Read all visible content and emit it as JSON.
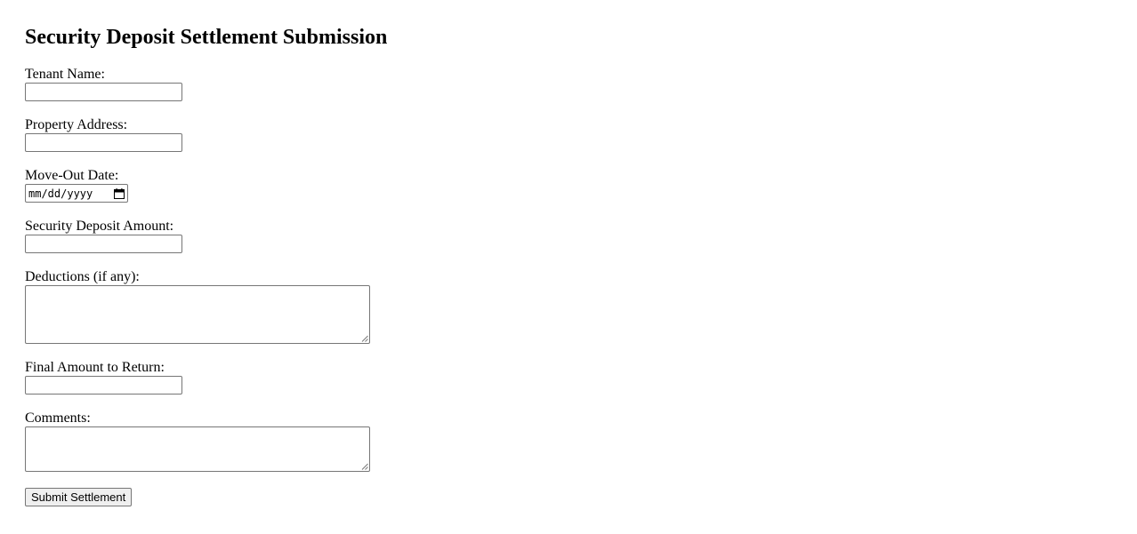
{
  "form": {
    "title": "Security Deposit Settlement Submission",
    "fields": {
      "tenant_name": {
        "label": "Tenant Name:",
        "value": ""
      },
      "property_address": {
        "label": "Property Address:",
        "value": ""
      },
      "move_out_date": {
        "label": "Move-Out Date:",
        "placeholder": "mm/dd/yyyy",
        "icon": "calendar-icon"
      },
      "deposit_amount": {
        "label": "Security Deposit Amount:",
        "value": ""
      },
      "deductions": {
        "label": "Deductions (if any):",
        "value": ""
      },
      "final_amount": {
        "label": "Final Amount to Return:",
        "value": ""
      },
      "comments": {
        "label": "Comments:",
        "value": ""
      }
    },
    "submit_label": "Submit Settlement"
  },
  "colors": {
    "input_border": "#767676",
    "button_background": "#efefef"
  }
}
